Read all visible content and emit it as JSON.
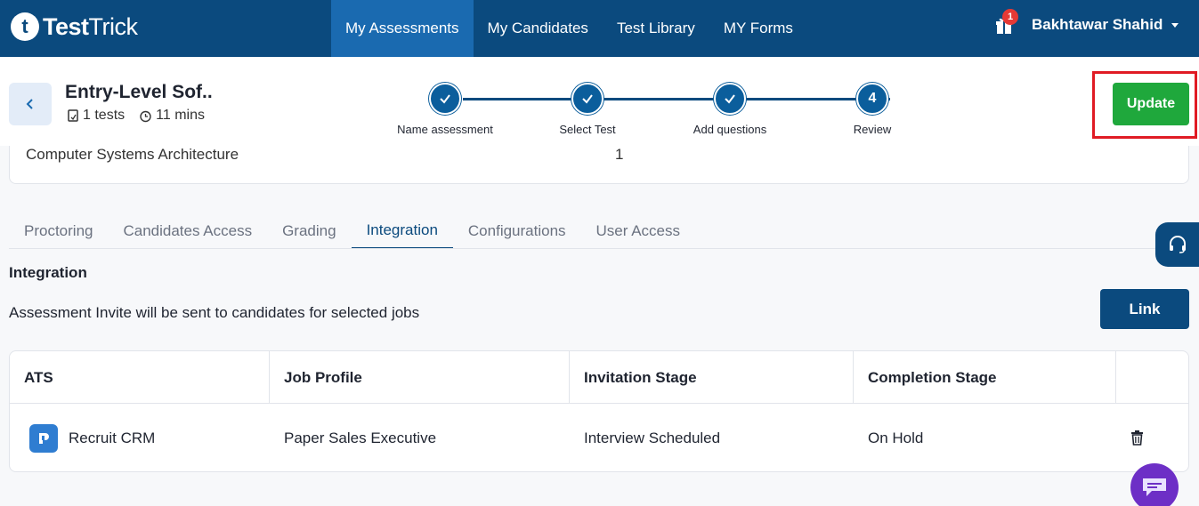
{
  "app": {
    "logo_mark": "t",
    "logo_bold": "Test",
    "logo_thin": "Trick"
  },
  "nav": {
    "items": [
      {
        "label": "My Assessments",
        "active": true
      },
      {
        "label": "My Candidates"
      },
      {
        "label": "Test Library"
      },
      {
        "label": "MY Forms"
      }
    ],
    "notification_count": "1",
    "user_name": "Bakhtawar Shahid"
  },
  "assessment": {
    "title": "Entry-Level Sof..",
    "tests": "1 tests",
    "duration": "11 mins"
  },
  "steps": [
    {
      "label": "Name assessment",
      "state": "done",
      "mark": ""
    },
    {
      "label": "Select Test",
      "state": "done",
      "mark": ""
    },
    {
      "label": "Add questions",
      "state": "done",
      "mark": ""
    },
    {
      "label": "Review",
      "state": "current",
      "mark": "4"
    }
  ],
  "actions": {
    "update_label": "Update",
    "link_label": "Link"
  },
  "card_peek": {
    "text": "Computer Systems Architecture",
    "count": "1"
  },
  "tabs": [
    "Proctoring",
    "Candidates Access",
    "Grading",
    "Integration",
    "Configurations",
    "User Access"
  ],
  "active_tab": "Integration",
  "integration": {
    "title": "Integration",
    "description": "Assessment Invite will be sent to candidates for selected jobs",
    "columns": [
      "ATS",
      "Job Profile",
      "Invitation Stage",
      "Completion Stage"
    ],
    "rows": [
      {
        "ats": "Recruit CRM",
        "job_profile": "Paper Sales Executive",
        "invitation_stage": "Interview Scheduled",
        "completion_stage": "On Hold"
      }
    ]
  },
  "colors": {
    "brand": "#0b4a7e",
    "active_nav": "#1a6ab0",
    "update": "#1fa83c",
    "highlight": "#e01b24",
    "chat": "#6d2fc6"
  }
}
